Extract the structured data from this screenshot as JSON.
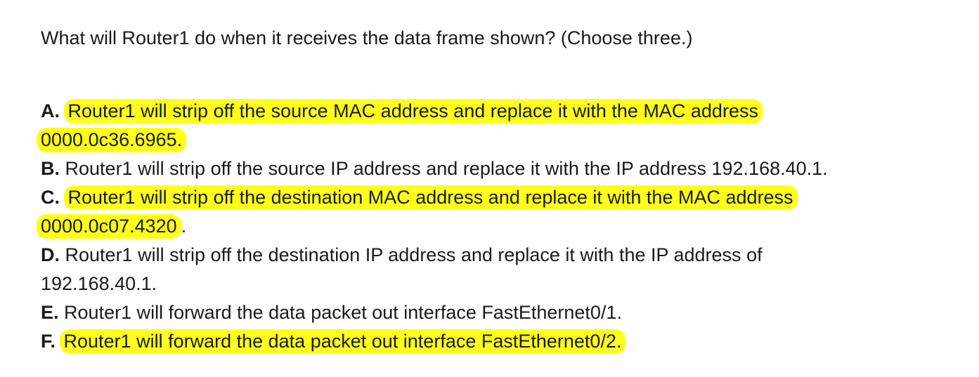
{
  "question": {
    "text": "What will Router1 do when it receives the data frame shown? (Choose three.)"
  },
  "options": {
    "a": {
      "letter": "A.",
      "line1": "Router1 will strip off the source MAC address and replace it with the MAC address",
      "line2": "0000.0c36.6965.",
      "highlighted": true
    },
    "b": {
      "letter": "B.",
      "line1": "Router1 will strip off the source IP address and replace it with the IP address 192.168.40.1.",
      "highlighted": false
    },
    "c": {
      "letter": "C.",
      "line1": "Router1 will strip off the destination MAC address and replace it with the MAC address",
      "line2": "0000.0c07.4320",
      "line2_tail": ".",
      "highlighted": true
    },
    "d": {
      "letter": "D.",
      "line1": "Router1 will strip off the destination IP address and replace it with the IP address of",
      "line2": "192.168.40.1.",
      "highlighted": false
    },
    "e": {
      "letter": "E.",
      "line1": "Router1 will forward the data packet out interface FastEthernet0/1.",
      "highlighted": false
    },
    "f": {
      "letter": "F.",
      "line1": "Router1 will forward the data packet out interface FastEthernet0/2.",
      "highlighted": true
    }
  },
  "colors": {
    "highlight": "#ffff1a",
    "text": "#1a1a1a",
    "background": "#ffffff"
  }
}
